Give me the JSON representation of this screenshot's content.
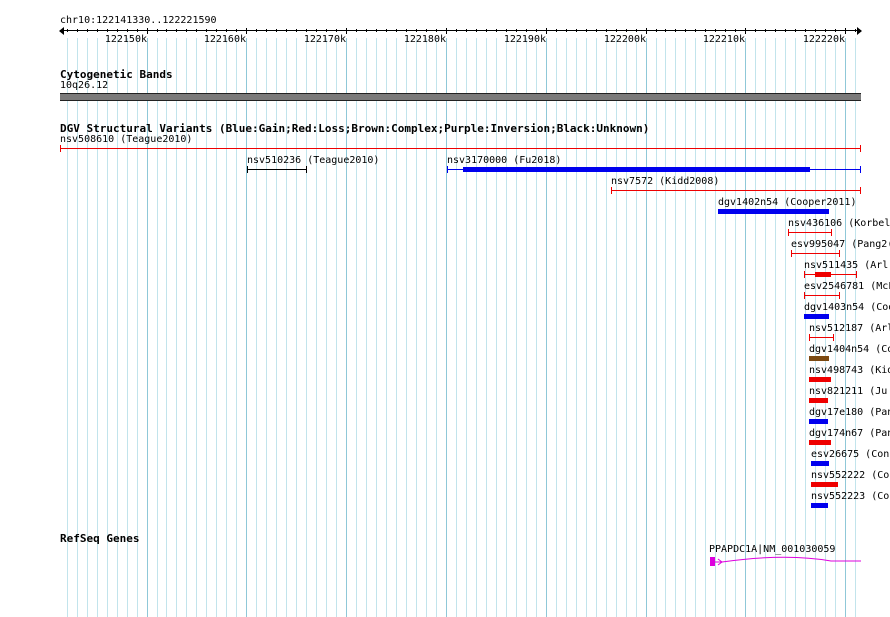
{
  "ruler": {
    "label": "chr10:122141330..122221590",
    "start": 122141330,
    "end": 122221590,
    "ticks": [
      {
        "pos": 122150000,
        "label": "122150k"
      },
      {
        "pos": 122160000,
        "label": "122160k"
      },
      {
        "pos": 122170000,
        "label": "122170k"
      },
      {
        "pos": 122180000,
        "label": "122180k"
      },
      {
        "pos": 122190000,
        "label": "122190k"
      },
      {
        "pos": 122200000,
        "label": "122200k"
      },
      {
        "pos": 122210000,
        "label": "122210k"
      },
      {
        "pos": 122220000,
        "label": "122220k"
      }
    ]
  },
  "cytoband": {
    "title": "Cytogenetic Bands",
    "band": "10q26.12"
  },
  "dgv": {
    "title": "DGV Structural Variants (Blue:Gain;Red:Loss;Brown:Complex;Purple:Inversion;Black:Unknown)",
    "colors": {
      "gain": "#0000ee",
      "loss": "#ee0000",
      "complex": "#7b4a12",
      "unknown": "#000000"
    },
    "variants": [
      {
        "label": "nsv508610 (Teague2010)",
        "start": 122141330,
        "end": 122221590,
        "type": "loss",
        "style": "line"
      },
      {
        "label": "nsv510236 (Teague2010)",
        "start": 122160100,
        "end": 122166100,
        "type": "unknown",
        "style": "line"
      },
      {
        "label": "nsv3170000 (Fu2018)",
        "start": 122180100,
        "end": 122221590,
        "type": "gain",
        "style": "thick",
        "thick_start": 122181700,
        "thick_end": 122216500
      },
      {
        "label": "nsv7572 (Kidd2008)",
        "start": 122196500,
        "end": 122221590,
        "type": "loss",
        "style": "line"
      },
      {
        "label": "dgv1402n54 (Cooper2011)",
        "start": 122207300,
        "end": 122218400,
        "type": "gain",
        "style": "bar"
      },
      {
        "label": "nsv436106 (Korbel",
        "start": 122214300,
        "end": 122218700,
        "type": "loss",
        "style": "line"
      },
      {
        "label": "esv995047 (Pang2(",
        "start": 122214600,
        "end": 122219500,
        "type": "loss",
        "style": "line"
      },
      {
        "label": "nsv511435 (Arl",
        "start": 122215900,
        "end": 122221200,
        "type": "loss",
        "style": "thick",
        "thick_start": 122217000,
        "thick_end": 122218600
      },
      {
        "label": "esv2546781 (McF",
        "start": 122215900,
        "end": 122219500,
        "type": "loss",
        "style": "line"
      },
      {
        "label": "dgv1403n54 (Coo",
        "start": 122215900,
        "end": 122218400,
        "type": "gain",
        "style": "bar"
      },
      {
        "label": "nsv512187 (Arl",
        "start": 122216400,
        "end": 122218900,
        "type": "loss",
        "style": "line"
      },
      {
        "label": "dgv1404n54 (Coo",
        "start": 122216400,
        "end": 122218400,
        "type": "complex",
        "style": "bar"
      },
      {
        "label": "nsv498743 (Kid",
        "start": 122216400,
        "end": 122218600,
        "type": "loss",
        "style": "bar"
      },
      {
        "label": "nsv821211 (Ju",
        "start": 122216400,
        "end": 122218300,
        "type": "loss",
        "style": "bar"
      },
      {
        "label": "dgv17e180 (Pan",
        "start": 122216400,
        "end": 122218300,
        "type": "gain",
        "style": "bar"
      },
      {
        "label": "dgv174n67 (Pan",
        "start": 122216400,
        "end": 122218600,
        "type": "loss",
        "style": "bar"
      },
      {
        "label": "esv26675 (Con",
        "start": 122216600,
        "end": 122218400,
        "type": "gain",
        "style": "bar"
      },
      {
        "label": "nsv552222 (Co",
        "start": 122216600,
        "end": 122219300,
        "type": "loss",
        "style": "bar"
      },
      {
        "label": "nsv552223 (Co",
        "start": 122216600,
        "end": 122218300,
        "type": "gain",
        "style": "bar"
      }
    ]
  },
  "refseq": {
    "title": "RefSeq Genes",
    "color": "#dd00dd",
    "genes": [
      {
        "label": "PPAPDC1A|NM_001030059",
        "start": 122206500,
        "end": 122221590,
        "exon_start": 122206500,
        "exon_end": 122207000
      }
    ]
  }
}
